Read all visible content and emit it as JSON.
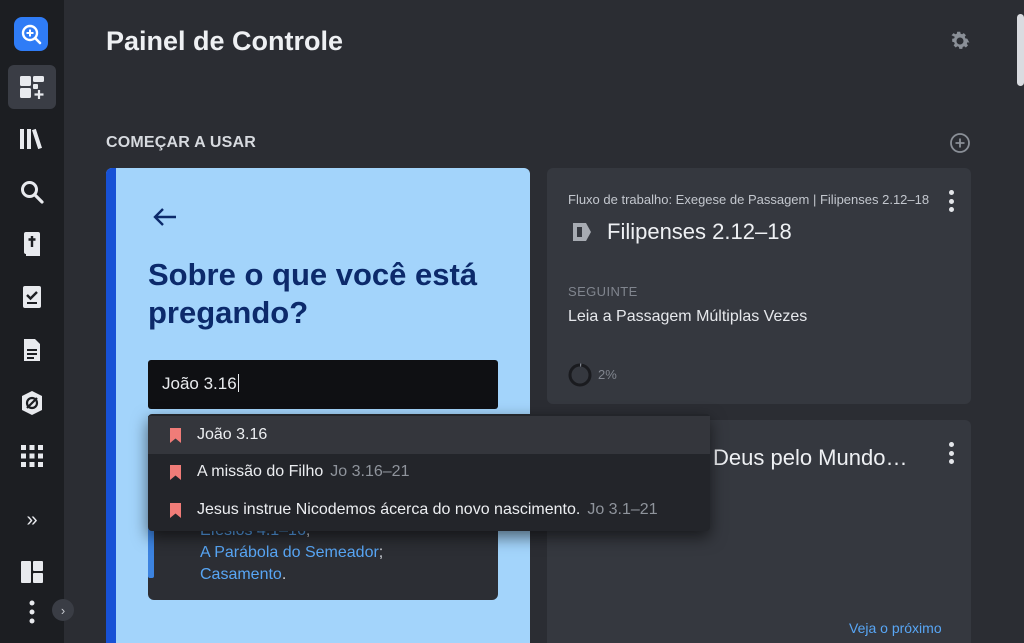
{
  "header": {
    "title": "Painel de Controle"
  },
  "section": {
    "title": "COMEÇAR A USAR"
  },
  "sidebar": {
    "items": [
      {
        "name": "dashboard",
        "icon": "dashboard-add-icon",
        "active": true
      },
      {
        "name": "library",
        "icon": "library-icon"
      },
      {
        "name": "search",
        "icon": "search-icon"
      },
      {
        "name": "bible",
        "icon": "bible-icon"
      },
      {
        "name": "tasks",
        "icon": "checklist-icon"
      },
      {
        "name": "documents",
        "icon": "document-icon"
      },
      {
        "name": "factbook",
        "icon": "factbook-icon"
      },
      {
        "name": "apps",
        "icon": "grid-icon"
      }
    ],
    "expand_label": "»",
    "collapse_label": "›"
  },
  "prompt_card": {
    "question": "Sobre o que você está pregando?",
    "search_value": "João 3.16",
    "examples": [
      {
        "text": "Efésios 4.1–16",
        "type": "link",
        "suffix": ";"
      },
      {
        "text": "A Parábola do Semeador",
        "type": "link",
        "suffix": ";"
      },
      {
        "text": "Casamento",
        "type": "link",
        "suffix": "."
      }
    ]
  },
  "dropdown": {
    "items": [
      {
        "title": "João 3.16",
        "ref": ""
      },
      {
        "title": "A missão do Filho",
        "ref": "Jo 3.16–21"
      },
      {
        "title": "Jesus instrue Nicodemos ácerca do novo nascimento.",
        "ref": "Jo 3.1–21"
      }
    ]
  },
  "workflow_card": {
    "breadcrumb": "Fluxo de trabalho: Exegese de Passagem | Filipenses 2.12–18",
    "passage": "Filipenses 2.12–18",
    "next_label": "SEGUINTE",
    "next_task": "Leia a Passagem Múltiplas Vezes",
    "progress_text": "2%",
    "progress": 0.02
  },
  "second_card": {
    "title_visible": "Deus pelo Mundo…",
    "link": "Veja o próximo"
  },
  "colors": {
    "accent": "#2f7cf6",
    "prompt_bg": "#a3d4fb",
    "bookmark": "#f07c78",
    "link": "#58a6f5"
  }
}
